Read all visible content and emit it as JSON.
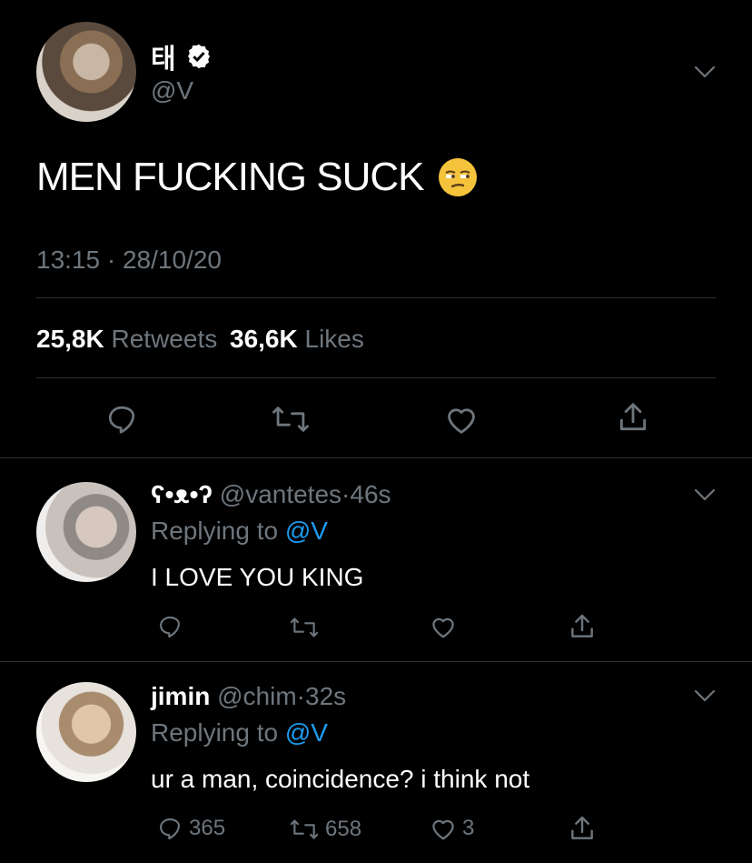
{
  "main_tweet": {
    "display_name": "태",
    "handle": "@V",
    "text": "MEN FUCKING SUCK",
    "emoji": "😒",
    "time": "13:15",
    "date_sep": "·",
    "date": "28/10/20",
    "retweets_count": "25,8K",
    "retweets_label": "Retweets",
    "likes_count": "36,6K",
    "likes_label": "Likes"
  },
  "replies": [
    {
      "display_name": "ʕ•ᴥ•ʔ",
      "handle": "@vantetes",
      "sep": "·",
      "time": "46s",
      "replying_prefix": "Replying to",
      "replying_to": "@V",
      "text": "I LOVE YOU KING"
    },
    {
      "display_name": "jimin",
      "handle": "@chim",
      "sep": "·",
      "time": "32s",
      "replying_prefix": "Replying to",
      "replying_to": "@V",
      "text": "ur a man, coincidence? i think not",
      "reply_count": "365",
      "retweet_count": "658",
      "like_count": "3"
    }
  ],
  "colors": {
    "background": "#000000",
    "text": "#d9d9d9",
    "muted": "#6e767d",
    "link": "#1d9bf0",
    "divider": "#2f3336"
  },
  "icons": [
    "verified-badge-icon",
    "chevron-down-icon",
    "reply-icon",
    "retweet-icon",
    "like-icon",
    "share-icon"
  ]
}
